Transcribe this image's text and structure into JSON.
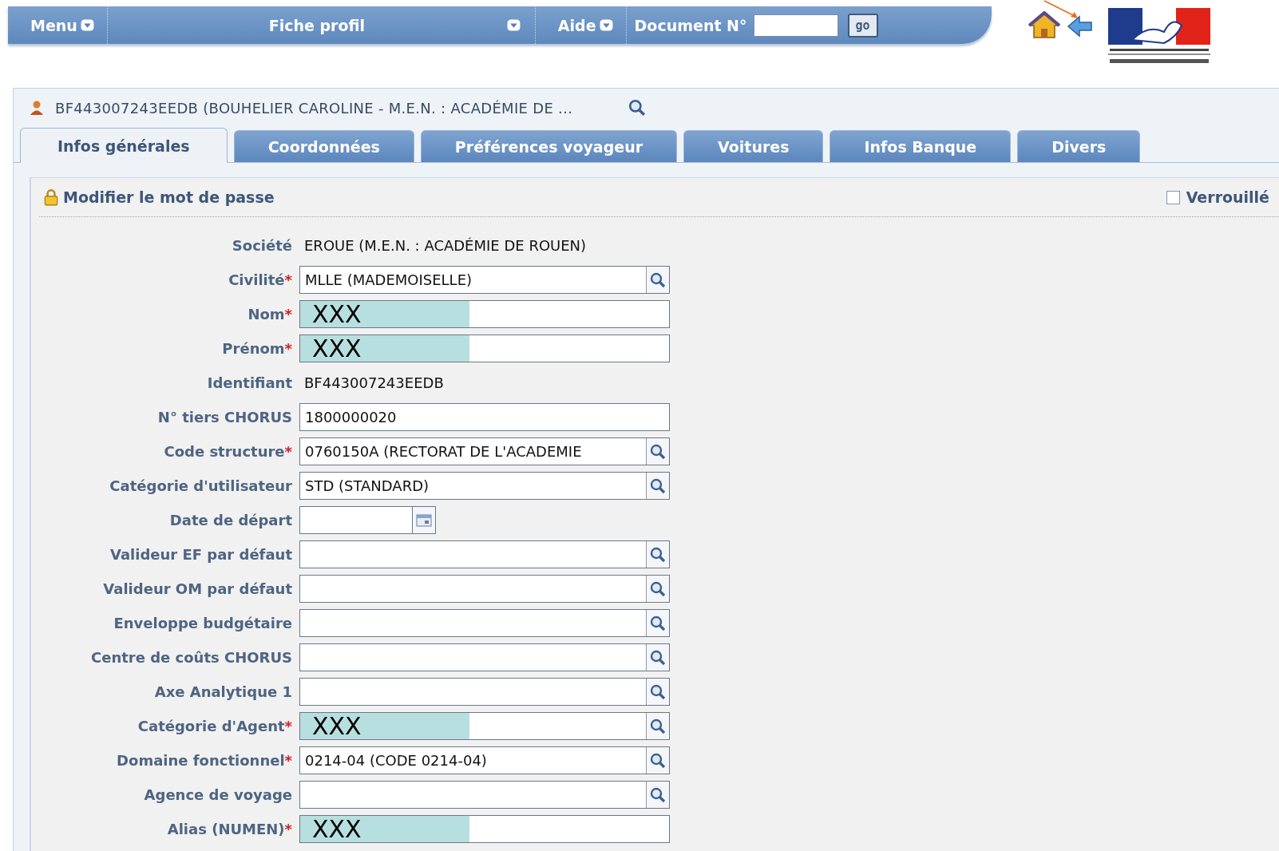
{
  "menubar": {
    "items": [
      {
        "label": "Menu",
        "kind": "menu"
      },
      {
        "label": "Fiche profil",
        "kind": "wide"
      },
      {
        "label": "Aide",
        "kind": "menu"
      }
    ],
    "document": {
      "label": "Document N°",
      "button": "go"
    }
  },
  "profile": {
    "title": "BF443007243EEDB (BOUHELIER CAROLINE - M.E.N. : ACADÉMIE DE ..."
  },
  "tabs": [
    {
      "label": "Infos générales",
      "selected": true
    },
    {
      "label": "Coordonnées",
      "selected": false
    },
    {
      "label": "Préférences voyageur",
      "selected": false
    },
    {
      "label": "Voitures",
      "selected": false
    },
    {
      "label": "Infos Banque",
      "selected": false
    },
    {
      "label": "Divers",
      "selected": false
    }
  ],
  "password_link": "Modifier le mot de passe",
  "locked": {
    "label": "Verrouillé",
    "checked": false
  },
  "fields": [
    {
      "label": "Société",
      "kind": "text",
      "value": "EROUE (M.E.N. : ACADÉMIE DE ROUEN)"
    },
    {
      "label": "Civilité",
      "mark": "*",
      "kind": "lookup",
      "value": "MLLE (MADEMOISELLE)"
    },
    {
      "label": "Nom",
      "mark": "*",
      "kind": "input",
      "value": "XXX",
      "redacted": true
    },
    {
      "label": "Prénom",
      "mark": "*",
      "kind": "input",
      "value": "XXX",
      "redacted": true
    },
    {
      "label": "Identifiant",
      "kind": "text",
      "value": "BF443007243EEDB"
    },
    {
      "label": "N° tiers CHORUS",
      "kind": "input",
      "value": "1800000020"
    },
    {
      "label": "Code structure",
      "mark": "*",
      "kind": "lookup",
      "value": "0760150A (RECTORAT DE L'ACADEMIE"
    },
    {
      "label": "Catégorie d'utilisateur",
      "kind": "lookup",
      "value": "STD (STANDARD)"
    },
    {
      "label": "Date de départ",
      "kind": "date"
    },
    {
      "label": "Valideur EF par défaut",
      "kind": "lookup"
    },
    {
      "label": "Valideur OM par défaut",
      "kind": "lookup"
    },
    {
      "label": "Enveloppe budgétaire",
      "kind": "lookup"
    },
    {
      "label": "Centre de coûts CHORUS",
      "kind": "lookup"
    },
    {
      "label": "Axe Analytique 1",
      "kind": "lookup"
    },
    {
      "label": "Catégorie d'Agent",
      "mark": "*",
      "kind": "lookup",
      "value": "XXX",
      "redacted": true
    },
    {
      "label": "Domaine fonctionnel",
      "mark": "*",
      "kind": "lookup",
      "value": "0214-04 (CODE 0214-04)"
    },
    {
      "label": "Agence de voyage",
      "kind": "lookup"
    },
    {
      "label": "Alias (NUMEN)",
      "mark": "*",
      "kind": "input",
      "value": "XXX",
      "redacted": true
    }
  ]
}
